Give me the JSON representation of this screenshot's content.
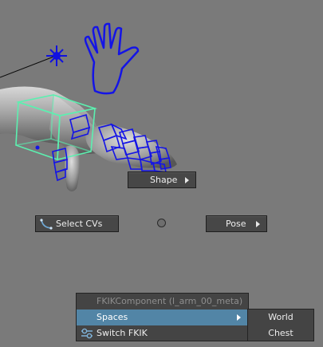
{
  "colors": {
    "viewport_bg": "#7a7a7a",
    "control_blue": "#1414e6",
    "selection_green": "#5cf0b0",
    "menu_bg": "#444444",
    "menu_highlight": "#5285a6",
    "button_bg": "#474747"
  },
  "marking_menu": {
    "shape_label": "Shape",
    "select_cvs_label": "Select CVs",
    "pose_label": "Pose"
  },
  "context_menu": {
    "header": "FKIKComponent (l_arm_00_meta)",
    "items": [
      {
        "label": "Spaces",
        "has_submenu": true,
        "highlighted": true
      },
      {
        "label": "Switch FKIK",
        "icon": "switch-fkik-icon"
      }
    ],
    "submenu": {
      "items": [
        {
          "label": "World"
        },
        {
          "label": "Chest"
        }
      ]
    }
  }
}
